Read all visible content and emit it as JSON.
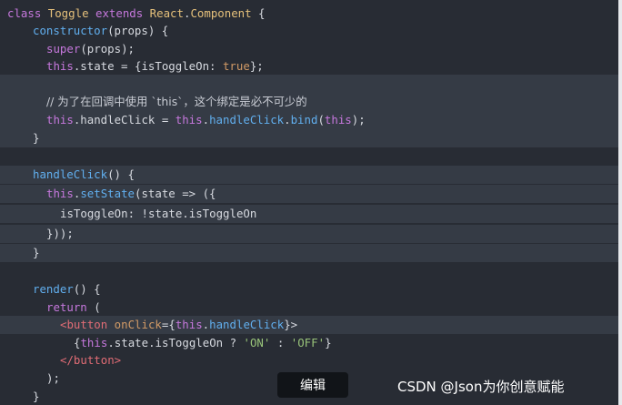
{
  "code": {
    "l01": {
      "c1": "class ",
      "c2": "Toggle",
      "c3": " extends ",
      "c4": "React",
      "c5": ".",
      "c6": "Component",
      "c7": " {"
    },
    "l02": {
      "c1": "constructor",
      "c2": "(props) {"
    },
    "l03": {
      "c1": "super",
      "c2": "(props);"
    },
    "l04": {
      "c1": "this",
      "c2": ".state = {isToggleOn: ",
      "c3": "true",
      "c4": "};"
    },
    "l06": {
      "c1": "// 为了在回调中使用 `this`，这个绑定是必不可少的"
    },
    "l07": {
      "c1": "this",
      "c2": ".handleClick = ",
      "c3": "this",
      "c4": ".",
      "c5": "handleClick",
      "c6": ".",
      "c7": "bind",
      "c8": "(",
      "c9": "this",
      "c10": ");"
    },
    "l08": {
      "c1": "}"
    },
    "l10": {
      "c1": "handleClick",
      "c2": "() {"
    },
    "l11": {
      "c1": "this",
      "c2": ".",
      "c3": "setState",
      "c4": "(state => ({"
    },
    "l12": {
      "c1": "isToggleOn: !state.isToggleOn"
    },
    "l13": {
      "c1": "}));"
    },
    "l14": {
      "c1": "}"
    },
    "l16": {
      "c1": "render",
      "c2": "() {"
    },
    "l17": {
      "c1": "return",
      "c2": " ("
    },
    "l18": {
      "c1": "<button",
      "c2": " onClick",
      "c3": "={",
      "c4": "this",
      "c5": ".",
      "c6": "handleClick",
      "c7": "}>"
    },
    "l19": {
      "c1": "{",
      "c2": "this",
      "c3": ".state.isToggleOn ? ",
      "c4": "'ON'",
      "c5": " : ",
      "c6": "'OFF'",
      "c7": "}"
    },
    "l20": {
      "c1": "</button>"
    },
    "l21": {
      "c1": ");"
    },
    "l22": {
      "c1": "}"
    }
  },
  "edit_button": {
    "label": "编辑"
  },
  "watermark": {
    "text": "CSDN @Json为你创意赋能"
  },
  "colors": {
    "background": "#282c34",
    "highlight_band": "#353b45",
    "keyword": "#c678dd",
    "function": "#61afef",
    "class_name": "#e5c07b",
    "boolean": "#d19a66",
    "string": "#98c379",
    "jsx_tag": "#e06c75"
  }
}
